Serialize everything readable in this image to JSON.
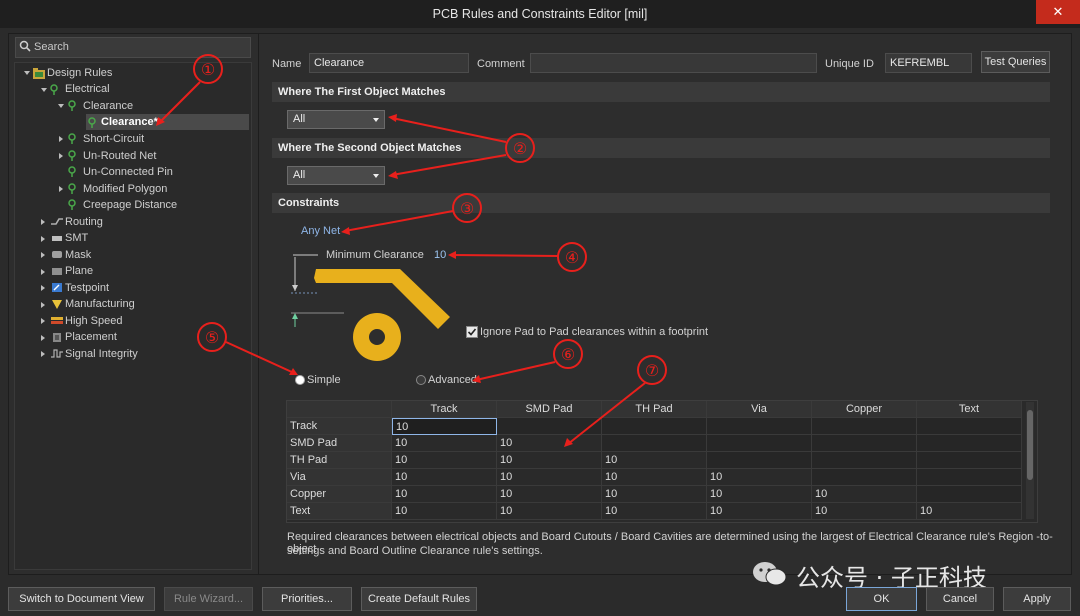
{
  "window": {
    "title": "PCB Rules and Constraints Editor [mil]",
    "close_glyph": "✕"
  },
  "search": {
    "placeholder": "Search"
  },
  "tree": [
    {
      "label": "Design Rules",
      "selected": false
    },
    {
      "label": "Electrical",
      "selected": false
    },
    {
      "label": "Clearance",
      "selected": false
    },
    {
      "label": "Clearance*",
      "selected": true
    },
    {
      "label": "Short-Circuit",
      "selected": false
    },
    {
      "label": "Un-Routed Net",
      "selected": false
    },
    {
      "label": "Un-Connected Pin",
      "selected": false
    },
    {
      "label": "Modified Polygon",
      "selected": false
    },
    {
      "label": "Creepage Distance",
      "selected": false
    },
    {
      "label": "Routing",
      "selected": false
    },
    {
      "label": "SMT",
      "selected": false
    },
    {
      "label": "Mask",
      "selected": false
    },
    {
      "label": "Plane",
      "selected": false
    },
    {
      "label": "Testpoint",
      "selected": false
    },
    {
      "label": "Manufacturing",
      "selected": false
    },
    {
      "label": "High Speed",
      "selected": false
    },
    {
      "label": "Placement",
      "selected": false
    },
    {
      "label": "Signal Integrity",
      "selected": false
    }
  ],
  "rule": {
    "name_label": "Name",
    "name_value": "Clearance",
    "comment_label": "Comment",
    "comment_value": "",
    "uid_label": "Unique ID",
    "uid_value": "KEFREMBL",
    "test_queries": "Test Queries"
  },
  "first_match": {
    "header": "Where The First Object Matches",
    "value": "All"
  },
  "second_match": {
    "header": "Where The Second Object Matches",
    "value": "All"
  },
  "constraints": {
    "header": "Constraints",
    "net_scope": "Any Net",
    "min_clearance_label": "Minimum Clearance",
    "min_clearance_value": "10",
    "ignore_pad_label": "Ignore Pad to Pad clearances within a footprint",
    "ignore_pad_checked": true,
    "mode_simple": "Simple",
    "mode_advanced": "Advanced",
    "selected_mode": "Simple"
  },
  "grid": {
    "columns": [
      "Track",
      "SMD Pad",
      "TH Pad",
      "Via",
      "Copper",
      "Text"
    ],
    "rows": [
      {
        "name": "Track",
        "values": [
          "10",
          "",
          "",
          "",
          "",
          ""
        ]
      },
      {
        "name": "SMD Pad",
        "values": [
          "10",
          "10",
          "",
          "",
          "",
          ""
        ]
      },
      {
        "name": "TH Pad",
        "values": [
          "10",
          "10",
          "10",
          "",
          "",
          ""
        ]
      },
      {
        "name": "Via",
        "values": [
          "10",
          "10",
          "10",
          "10",
          "",
          ""
        ]
      },
      {
        "name": "Copper",
        "values": [
          "10",
          "10",
          "10",
          "10",
          "10",
          ""
        ]
      },
      {
        "name": "Text",
        "values": [
          "10",
          "10",
          "10",
          "10",
          "10",
          "10"
        ]
      }
    ]
  },
  "note": {
    "line1": "Required clearances between electrical objects and Board Cutouts / Board Cavities are determined using the largest of Electrical Clearance rule's Region -to- object",
    "line2": "settings and Board Outline Clearance rule's settings."
  },
  "watermark": {
    "text": "公众号 · 子正科技"
  },
  "annotations": [
    "①",
    "②",
    "③",
    "④",
    "⑤",
    "⑥",
    "⑦"
  ],
  "footer": {
    "switch_view": "Switch to Document View",
    "rule_wizard": "Rule Wizard...",
    "priorities": "Priorities...",
    "create_default": "Create Default Rules",
    "ok": "OK",
    "cancel": "Cancel",
    "apply": "Apply"
  },
  "colors": {
    "accent_red": "#e8201c",
    "pad_yellow": "#e8b01c",
    "selection": "#4a4a4a",
    "link_blue": "#8fb6e8"
  }
}
